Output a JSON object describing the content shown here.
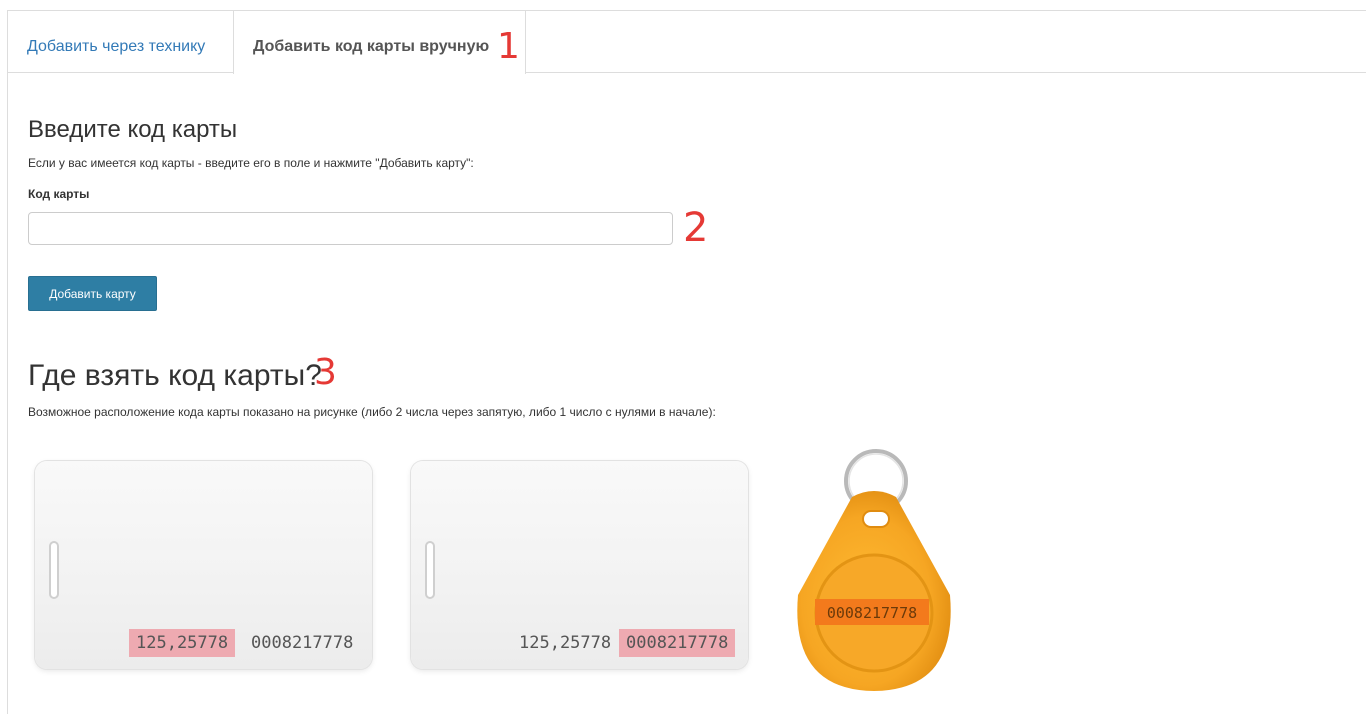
{
  "tabs": [
    {
      "label": "Добавить через технику",
      "active": false
    },
    {
      "label": "Добавить код карты вручную",
      "active": true
    }
  ],
  "markers": {
    "m1": "1",
    "m2": "2",
    "m3": "3"
  },
  "manual": {
    "title": "Введите код карты",
    "description": "Если у вас имеется код карты - введите его в поле и нажмите \"Добавить карту\":",
    "field_label": "Код карты",
    "field_value": "",
    "submit_label": "Добавить карту"
  },
  "help": {
    "title": "Где взять код карты?",
    "description": "Возможное расположение кода карты показано на рисунке (либо 2 числа через запятую, либо 1 число с нулями в начале):",
    "card_1": {
      "code_a": "125,25778",
      "code_b": "0008217778",
      "highlighted": "code_a"
    },
    "card_2": {
      "code_a": "125,25778",
      "code_b": "0008217778",
      "highlighted": "code_b"
    },
    "keyfob": {
      "code": "0008217778"
    }
  },
  "colors": {
    "link": "#337ab7",
    "button": "#2e7ea4",
    "marker": "#e53935",
    "highlight": "#eeaab1",
    "keyfob": "#f6a623"
  }
}
